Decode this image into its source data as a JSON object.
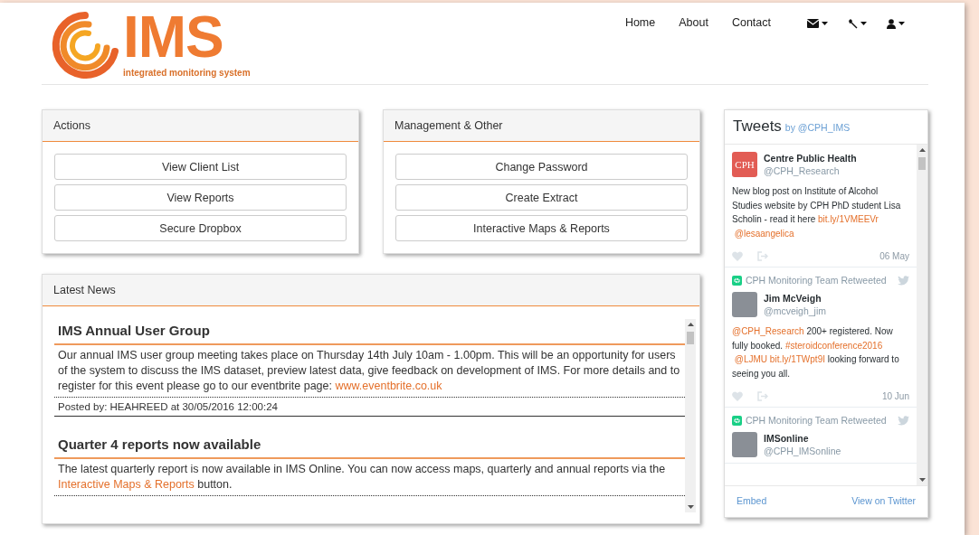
{
  "logo": {
    "title": "IMS",
    "tagline": "integrated monitoring system"
  },
  "nav": {
    "links": [
      "Home",
      "About",
      "Contact"
    ],
    "menus": [
      {
        "kind": "mail"
      },
      {
        "kind": "tools"
      },
      {
        "kind": "user"
      }
    ]
  },
  "panels": [
    {
      "title": "Actions",
      "buttons": [
        "View Client List",
        "View Reports",
        "Secure Dropbox"
      ]
    },
    {
      "title": "Management & Other",
      "buttons": [
        "Change Password",
        "Create Extract",
        "Interactive Maps & Reports"
      ]
    }
  ],
  "news": {
    "title": "Latest News",
    "items": [
      {
        "heading": "IMS Annual User Group",
        "body": [
          {
            "kind": "text",
            "text": "Our annual IMS user group meeting takes place on Thursday 14th July 10am - 1.00pm. This will be an opportunity for users of the system to discuss the IMS dataset, preview latest data, give feedback on development of IMS. For more details and to register for this event please go to our eventbrite page: "
          },
          {
            "kind": "link",
            "text": "www.eventbrite.co.uk"
          }
        ],
        "posted": "Posted by: HEAHREED at 30/05/2016 12:00:24"
      },
      {
        "heading": "Quarter 4 reports now available",
        "body": [
          {
            "kind": "text",
            "text": "The latest quarterly report is now available in IMS Online. You can now access maps, quarterly and annual reports via the "
          },
          {
            "kind": "link",
            "text": "Interactive Maps & Reports"
          },
          {
            "kind": "text",
            "text": " button."
          }
        ]
      }
    ]
  },
  "tweets": {
    "title": "Tweets",
    "by": "by @CPH_IMS",
    "items": [
      {
        "kind": "logo-avatar",
        "avatar_text": "CPH",
        "name": "Centre Public Health",
        "handle": "@CPH_Research",
        "body": [
          {
            "kind": "text",
            "text": "New blog post on Institute of Alcohol Studies website by CPH PhD student Lisa Scholin - read it here "
          },
          {
            "kind": "link",
            "text": "bit.ly/1VMEEVr"
          },
          {
            "kind": "link",
            "text": "@lesaangelica"
          }
        ],
        "date": "06 May"
      },
      {
        "kind": "photo-avatar",
        "retweeted_by": "CPH Monitoring Team Retweeted",
        "name": "Jim McVeigh",
        "handle": "@mcveigh_jim",
        "body": [
          {
            "kind": "link",
            "text": "@CPH_Research"
          },
          {
            "kind": "text",
            "text": " 200+ registered. Now fully booked. "
          },
          {
            "kind": "link",
            "text": "#steroidconference2016"
          },
          {
            "kind": "link",
            "text": "@LJMU"
          },
          {
            "kind": "link",
            "text": "bit.ly/1TWpt9I"
          },
          {
            "kind": "text",
            "text": " looking forward to seeing you all."
          }
        ],
        "date": "10 Jun"
      },
      {
        "kind": "photo-avatar",
        "retweeted_by": "CPH Monitoring Team Retweeted",
        "name": "IMSonline",
        "handle": "@CPH_IMSonline"
      }
    ],
    "footer": [
      "Embed",
      "View on Twitter"
    ]
  }
}
